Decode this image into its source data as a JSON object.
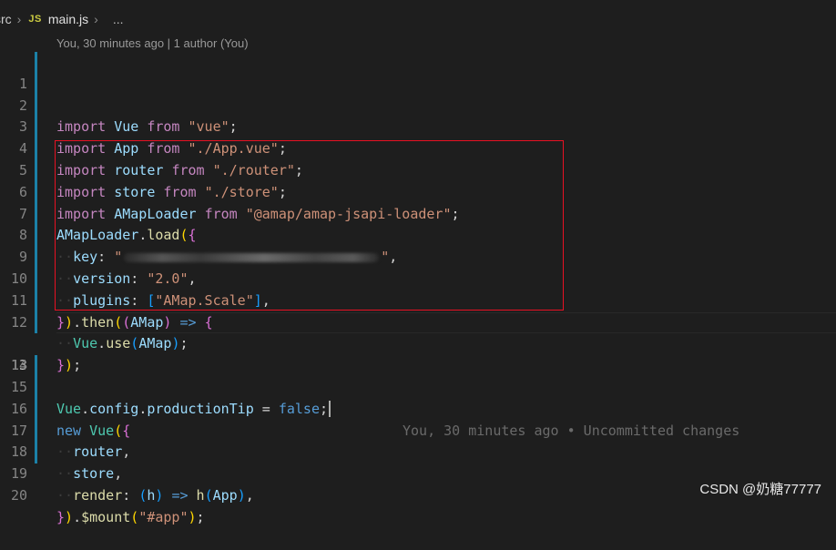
{
  "breadcrumb": {
    "folder": "src",
    "file_icon": "JS",
    "file": "main.js",
    "more": "..."
  },
  "codelens": "You, 30 minutes ago | 1 author (You)",
  "line_numbers": [
    "1",
    "2",
    "3",
    "4",
    "5",
    "6",
    "7",
    "8",
    "9",
    "10",
    "11",
    "12",
    "13",
    "14",
    "15",
    "16",
    "17",
    "18",
    "19",
    "20"
  ],
  "code": {
    "l1": [
      "import",
      "Vue",
      "from",
      "\"vue\"",
      ";"
    ],
    "l2": [
      "import",
      "App",
      "from",
      "\"./App.vue\"",
      ";"
    ],
    "l3": [
      "import",
      "router",
      "from",
      "\"./router\"",
      ";"
    ],
    "l4": [
      "import",
      "store",
      "from",
      "\"./store\"",
      ";"
    ],
    "l5": [
      "import",
      "AMapLoader",
      "from",
      "\"@amap/amap-jsapi-loader\"",
      ";"
    ],
    "l6": [
      "AMapLoader",
      ".",
      "load",
      "(",
      "{"
    ],
    "l7": [
      "key",
      ":",
      "\"",
      "\"",
      ","
    ],
    "l8": [
      "version",
      ":",
      "\"2.0\"",
      ","
    ],
    "l9": [
      "plugins",
      ":",
      "[",
      "\"AMap.Scale\"",
      "]",
      ","
    ],
    "l10": [
      "}",
      ")",
      ".",
      "then",
      "(",
      "(",
      "AMap",
      ")",
      "=>",
      "{"
    ],
    "l11": [
      "Vue",
      ".",
      "use",
      "(",
      "AMap",
      ")",
      ";"
    ],
    "l12": [
      "}",
      ")",
      ";"
    ],
    "l13": [
      "Vue",
      ".",
      "config",
      ".",
      "productionTip",
      "=",
      "false",
      ";"
    ],
    "l15": [
      "new",
      "Vue",
      "(",
      "{"
    ],
    "l16": [
      "router",
      ","
    ],
    "l17": [
      "store",
      ","
    ],
    "l18": [
      "render",
      ":",
      "(",
      "h",
      ")",
      "=>",
      "h",
      "(",
      "App",
      ")",
      ","
    ],
    "l19": [
      "}",
      ")",
      ".",
      "$mount",
      "(",
      "\"#app\"",
      ")",
      ";"
    ]
  },
  "blame_text": "You, 30 minutes ago • Uncommitted changes",
  "watermark": "CSDN @奶糖77777",
  "colors": {
    "background": "#1e1e1e",
    "keyword": "#c586c0",
    "string": "#ce9178",
    "variable": "#9cdcfe",
    "annotation_box": "#e81123"
  }
}
